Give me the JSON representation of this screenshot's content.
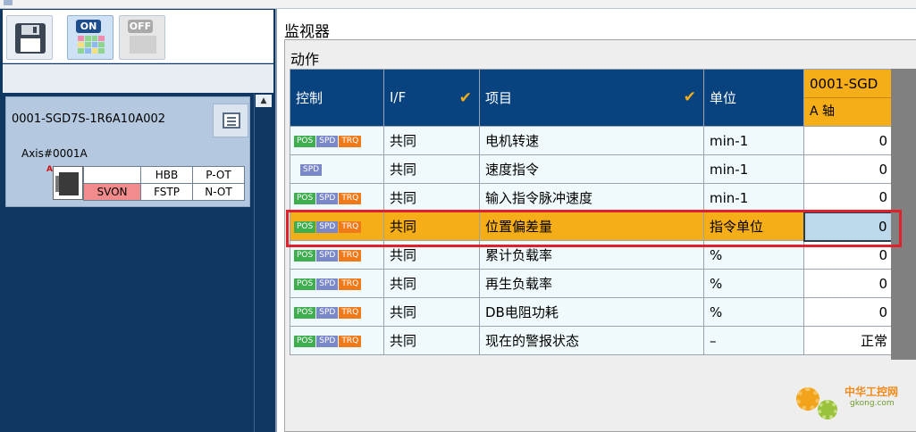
{
  "left_panel": {
    "toolbar": {
      "on_label": "ON",
      "off_label": "OFF"
    },
    "axis_card": {
      "title": "0001-SGD7S-1R6A10A002",
      "axis_name": "Axis#0001A",
      "axis_letter": "A",
      "status": {
        "row1": [
          "",
          "HBB",
          "P-OT"
        ],
        "row2": [
          "SVON",
          "FSTP",
          "N-OT"
        ]
      }
    }
  },
  "monitor": {
    "title": "监视器",
    "section": "动作",
    "headers": {
      "control": "控制",
      "if": "I/F",
      "item": "项目",
      "unit": "单位",
      "axis_id": "0001-SGD",
      "axis_name": "A 轴"
    },
    "badges": {
      "pos": "POS",
      "spd": "SPD",
      "trq": "TRQ"
    },
    "rows": [
      {
        "badges": [
          "POS",
          "SPD",
          "TRQ"
        ],
        "if": "共同",
        "item": "电机转速",
        "unit": "min-1",
        "value": "0"
      },
      {
        "badges": [
          "SPD"
        ],
        "if": "共同",
        "item": "速度指令",
        "unit": "min-1",
        "value": "0"
      },
      {
        "badges": [
          "POS",
          "SPD",
          "TRQ"
        ],
        "if": "共同",
        "item": "输入指令脉冲速度",
        "unit": "min-1",
        "value": "0"
      },
      {
        "badges": [
          "POS",
          "SPD",
          "TRQ"
        ],
        "if": "共同",
        "item": "位置偏差量",
        "unit": "指令单位",
        "value": "0",
        "highlighted": true
      },
      {
        "badges": [
          "POS",
          "SPD",
          "TRQ"
        ],
        "if": "共同",
        "item": "累计负载率",
        "unit": "%",
        "value": "0"
      },
      {
        "badges": [
          "POS",
          "SPD",
          "TRQ"
        ],
        "if": "共同",
        "item": "再生负载率",
        "unit": "%",
        "value": "0"
      },
      {
        "badges": [
          "POS",
          "SPD",
          "TRQ"
        ],
        "if": "共同",
        "item": "DB电阻功耗",
        "unit": "%",
        "value": "0"
      },
      {
        "badges": [
          "POS",
          "SPD",
          "TRQ"
        ],
        "if": "共同",
        "item": "现在的警报状态",
        "unit": "–",
        "value": "正常"
      }
    ]
  },
  "watermark": {
    "cn": "中华工控网",
    "en": "gkong.com"
  },
  "colors": {
    "header_blue": "#08427f",
    "highlight_orange": "#f5ad18",
    "selection_red": "#e0202a",
    "left_panel_navy": "#0f3762"
  }
}
